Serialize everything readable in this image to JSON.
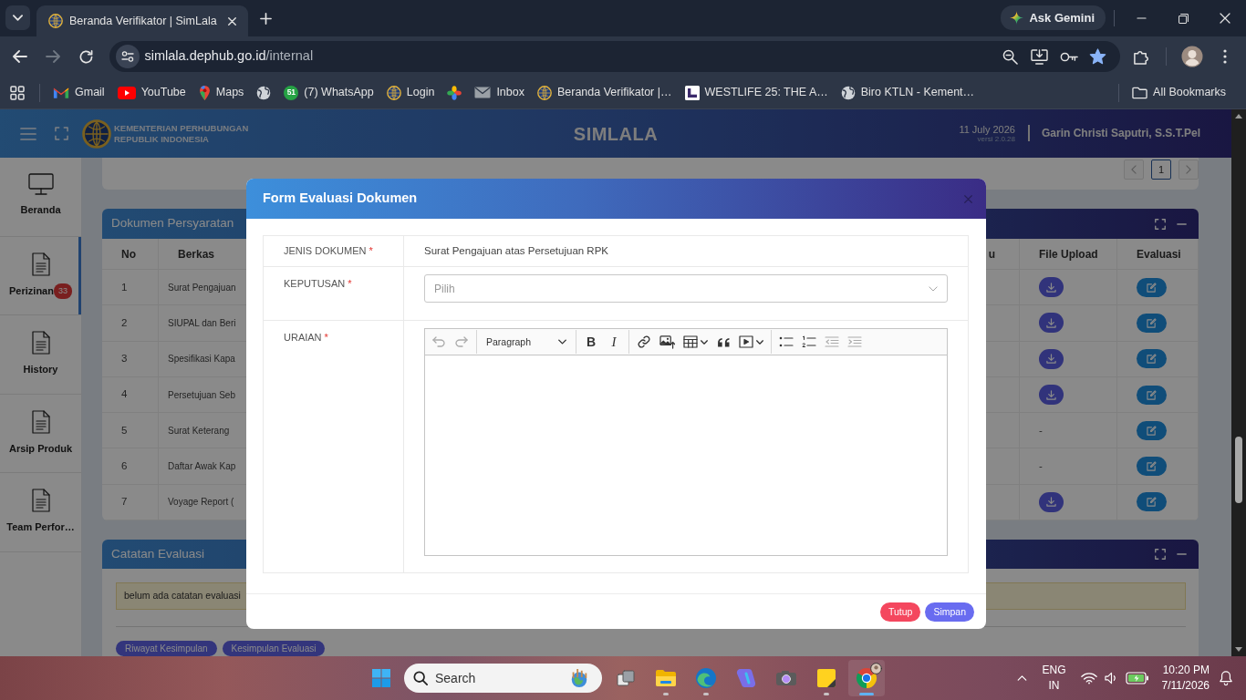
{
  "browser": {
    "tab": {
      "title": "Beranda Verifikator | SimLala"
    },
    "gemini": "Ask Gemini",
    "nav": [
      {
        "kind": "back",
        "disabled": false
      },
      {
        "kind": "forward",
        "disabled": true
      },
      {
        "kind": "reload",
        "disabled": false
      }
    ],
    "url": {
      "host": "simlala.dephub.go.id",
      "path": "/internal"
    },
    "bookmarked": true,
    "bookmarks": [
      {
        "kind": "gmail",
        "label": "Gmail"
      },
      {
        "kind": "youtube",
        "label": "YouTube"
      },
      {
        "kind": "maps",
        "label": "Maps"
      },
      {
        "kind": "globe"
      },
      {
        "kind": "whatsapp",
        "badge": "51",
        "label": "(7) WhatsApp"
      },
      {
        "kind": "emblem",
        "label": "Login"
      },
      {
        "kind": "pinwheel"
      },
      {
        "kind": "mail",
        "label": "Inbox"
      },
      {
        "kind": "emblem",
        "label": "Beranda Verifikator |…"
      },
      {
        "kind": "logo",
        "label": "WESTLIFE 25: THE A…"
      },
      {
        "kind": "globe",
        "label": "Biro KTLN - Kement…"
      }
    ],
    "all_bookmarks": "All Bookmarks"
  },
  "app": {
    "org": [
      "KEMENTERIAN PERHUBUNGAN",
      "REPUBLIK INDONESIA"
    ],
    "title": "SIMLALA",
    "date": "11 July 2026",
    "version": "versi 2.0.28",
    "user": "Garin Christi Saputri, S.S.T.Pel"
  },
  "sidebar": {
    "items": [
      {
        "kind": "dashboard",
        "label": "Beranda",
        "selected": false
      },
      {
        "kind": "module",
        "label": "Perizinan",
        "badge": "33",
        "selected": true
      },
      {
        "kind": "module",
        "label": "History",
        "selected": false
      },
      {
        "kind": "module",
        "label": "Arsip Produk",
        "selected": false
      },
      {
        "kind": "module",
        "label": "Team Perfor…",
        "selected": false
      }
    ]
  },
  "pager": {
    "pages": [
      {
        "label": "1",
        "selected": true
      }
    ]
  },
  "documents": {
    "title": "Dokumen Persyaratan",
    "columns": [
      "No",
      "Berkas",
      "u",
      "File Upload",
      "Evaluasi"
    ],
    "rows": [
      {
        "no": "1",
        "file": "Surat Pengajuan",
        "upload": {
          "kind": "download"
        }
      },
      {
        "no": "2",
        "file": "SIUPAL dan Beri",
        "upload": {
          "kind": "download"
        }
      },
      {
        "no": "3",
        "file": "Spesifikasi Kapa",
        "upload": {
          "kind": "download"
        }
      },
      {
        "no": "4",
        "file": "Persetujuan Seb",
        "upload": {
          "kind": "download"
        }
      },
      {
        "no": "5",
        "file": "Surat Keterang",
        "upload": {
          "kind": "text",
          "text": "-"
        }
      },
      {
        "no": "6",
        "file": "Daftar Awak Kap",
        "upload": {
          "kind": "text",
          "text": "-"
        }
      },
      {
        "no": "7",
        "file": "Voyage Report (",
        "upload": {
          "kind": "download"
        }
      }
    ]
  },
  "notes": {
    "title": "Catatan Evaluasi",
    "alert": "belum ada catatan evaluasi",
    "buttons": [
      "Riwayat Kesimpulan",
      "Kesimpulan Evaluasi"
    ]
  },
  "modal": {
    "title": "Form Evaluasi Dokumen",
    "fields": [
      {
        "kind": "text",
        "label": "JENIS DOKUMEN",
        "required_mark": "*",
        "value": "Surat Pengajuan atas Persetujuan RPK"
      },
      {
        "kind": "select",
        "label": "KEPUTUSAN",
        "required_mark": "*",
        "placeholder": "Pilih"
      },
      {
        "kind": "editor",
        "label": "URAIAN",
        "required_mark": "*",
        "toolbar": [
          {
            "tools": [
              {
                "kind": "undo",
                "disabled": true
              },
              {
                "kind": "redo",
                "disabled": true
              }
            ]
          },
          {
            "tools": [
              {
                "kind": "heading",
                "text": "Paragraph",
                "disabled": false
              }
            ]
          },
          {
            "tools": [
              {
                "kind": "bold",
                "text": "B",
                "disabled": false
              },
              {
                "kind": "italic",
                "text": "I",
                "disabled": false
              }
            ]
          },
          {
            "tools": [
              {
                "kind": "link",
                "disabled": false
              },
              {
                "kind": "image",
                "disabled": false
              },
              {
                "kind": "table",
                "disabled": false
              },
              {
                "kind": "quote",
                "disabled": false
              },
              {
                "kind": "media",
                "disabled": false
              }
            ]
          },
          {
            "tools": [
              {
                "kind": "bulleted",
                "disabled": false
              },
              {
                "kind": "numbered",
                "disabled": false
              },
              {
                "kind": "outdent",
                "disabled": true
              },
              {
                "kind": "indent",
                "disabled": true
              }
            ]
          }
        ]
      }
    ],
    "buttons": [
      {
        "kind": "danger",
        "label": "Tutup"
      },
      {
        "kind": "primary",
        "label": "Simpan"
      }
    ]
  },
  "taskbar": {
    "search": {
      "placeholder": "Search"
    },
    "apps": [
      {
        "kind": "task-view",
        "running": false,
        "selected": false
      },
      {
        "kind": "files",
        "running": true,
        "selected": false
      },
      {
        "kind": "edge",
        "running": true,
        "selected": false
      },
      {
        "kind": "copilot",
        "running": false,
        "selected": false
      },
      {
        "kind": "camera",
        "running": false,
        "selected": false
      },
      {
        "kind": "notes",
        "running": true,
        "selected": false
      },
      {
        "kind": "chrome",
        "running": true,
        "selected": true
      }
    ],
    "language": [
      "ENG",
      "IN"
    ],
    "time": "10:20 PM",
    "date": "7/11/2026"
  }
}
